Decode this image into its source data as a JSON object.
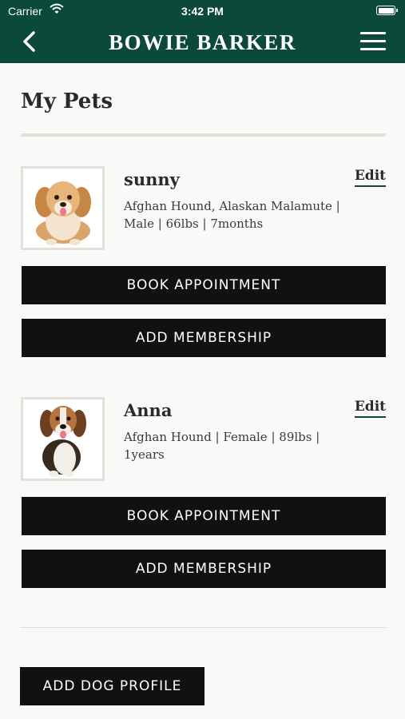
{
  "status_bar": {
    "carrier": "Carrier",
    "time": "3:42 PM"
  },
  "header": {
    "title": "BOWIE BARKER",
    "back_icon": "chevron-left-icon",
    "menu_icon": "hamburger-menu-icon",
    "background_color": "#0b4a3a"
  },
  "page": {
    "title": "My Pets"
  },
  "pets": [
    {
      "name": "sunny",
      "details": "Afghan Hound, Alaskan Malamute | Male | 66lbs | 7months",
      "edit_label": "Edit",
      "book_label": "BOOK APPOINTMENT",
      "membership_label": "ADD MEMBERSHIP",
      "photo": "puppy-photo"
    },
    {
      "name": "Anna",
      "details": "Afghan Hound | Female | 89lbs | 1years",
      "edit_label": "Edit",
      "book_label": "BOOK APPOINTMENT",
      "membership_label": "ADD MEMBERSHIP",
      "photo": "beagle-photo"
    }
  ],
  "footer": {
    "add_profile_label": "ADD DOG PROFILE"
  }
}
